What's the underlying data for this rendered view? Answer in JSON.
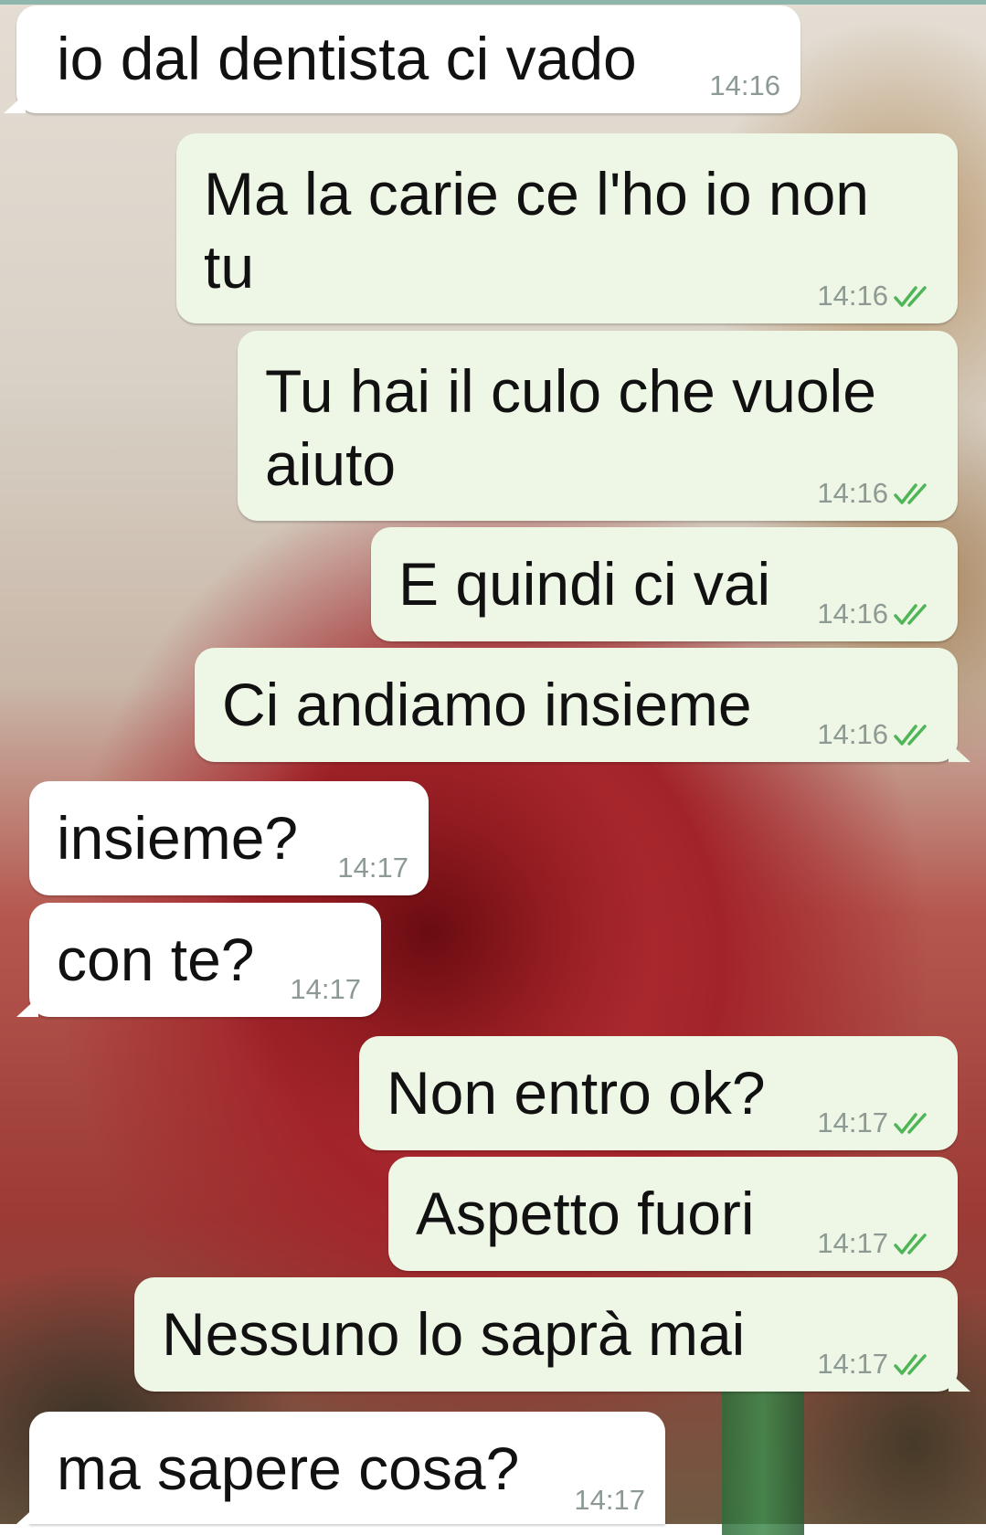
{
  "colors": {
    "incoming_bubble": "#ffffff",
    "outgoing_bubble": "#eef7e6",
    "timestamp": "#8d9a94",
    "read_check": "#4fb558"
  },
  "messages": [
    {
      "direction": "in",
      "text": "io dal dentista ci vado",
      "time": "14:16"
    },
    {
      "direction": "out",
      "text": "Ma la carie ce l'ho io non tu",
      "time": "14:16",
      "status_icon": "double-check-icon"
    },
    {
      "direction": "out",
      "text": "Tu hai il culo che vuole aiuto",
      "time": "14:16",
      "status_icon": "double-check-icon"
    },
    {
      "direction": "out",
      "text": "E quindi ci vai",
      "time": "14:16",
      "status_icon": "double-check-icon"
    },
    {
      "direction": "out",
      "text": "Ci andiamo insieme",
      "time": "14:16",
      "status_icon": "double-check-icon"
    },
    {
      "direction": "in",
      "text": "insieme?",
      "time": "14:17"
    },
    {
      "direction": "in",
      "text": "con te?",
      "time": "14:17"
    },
    {
      "direction": "out",
      "text": "Non entro ok?",
      "time": "14:17",
      "status_icon": "double-check-icon"
    },
    {
      "direction": "out",
      "text": "Aspetto fuori",
      "time": "14:17",
      "status_icon": "double-check-icon"
    },
    {
      "direction": "out",
      "text": "Nessuno lo saprà mai",
      "time": "14:17",
      "status_icon": "double-check-icon"
    },
    {
      "direction": "in",
      "text": "ma sapere cosa?",
      "time": "14:17"
    }
  ]
}
